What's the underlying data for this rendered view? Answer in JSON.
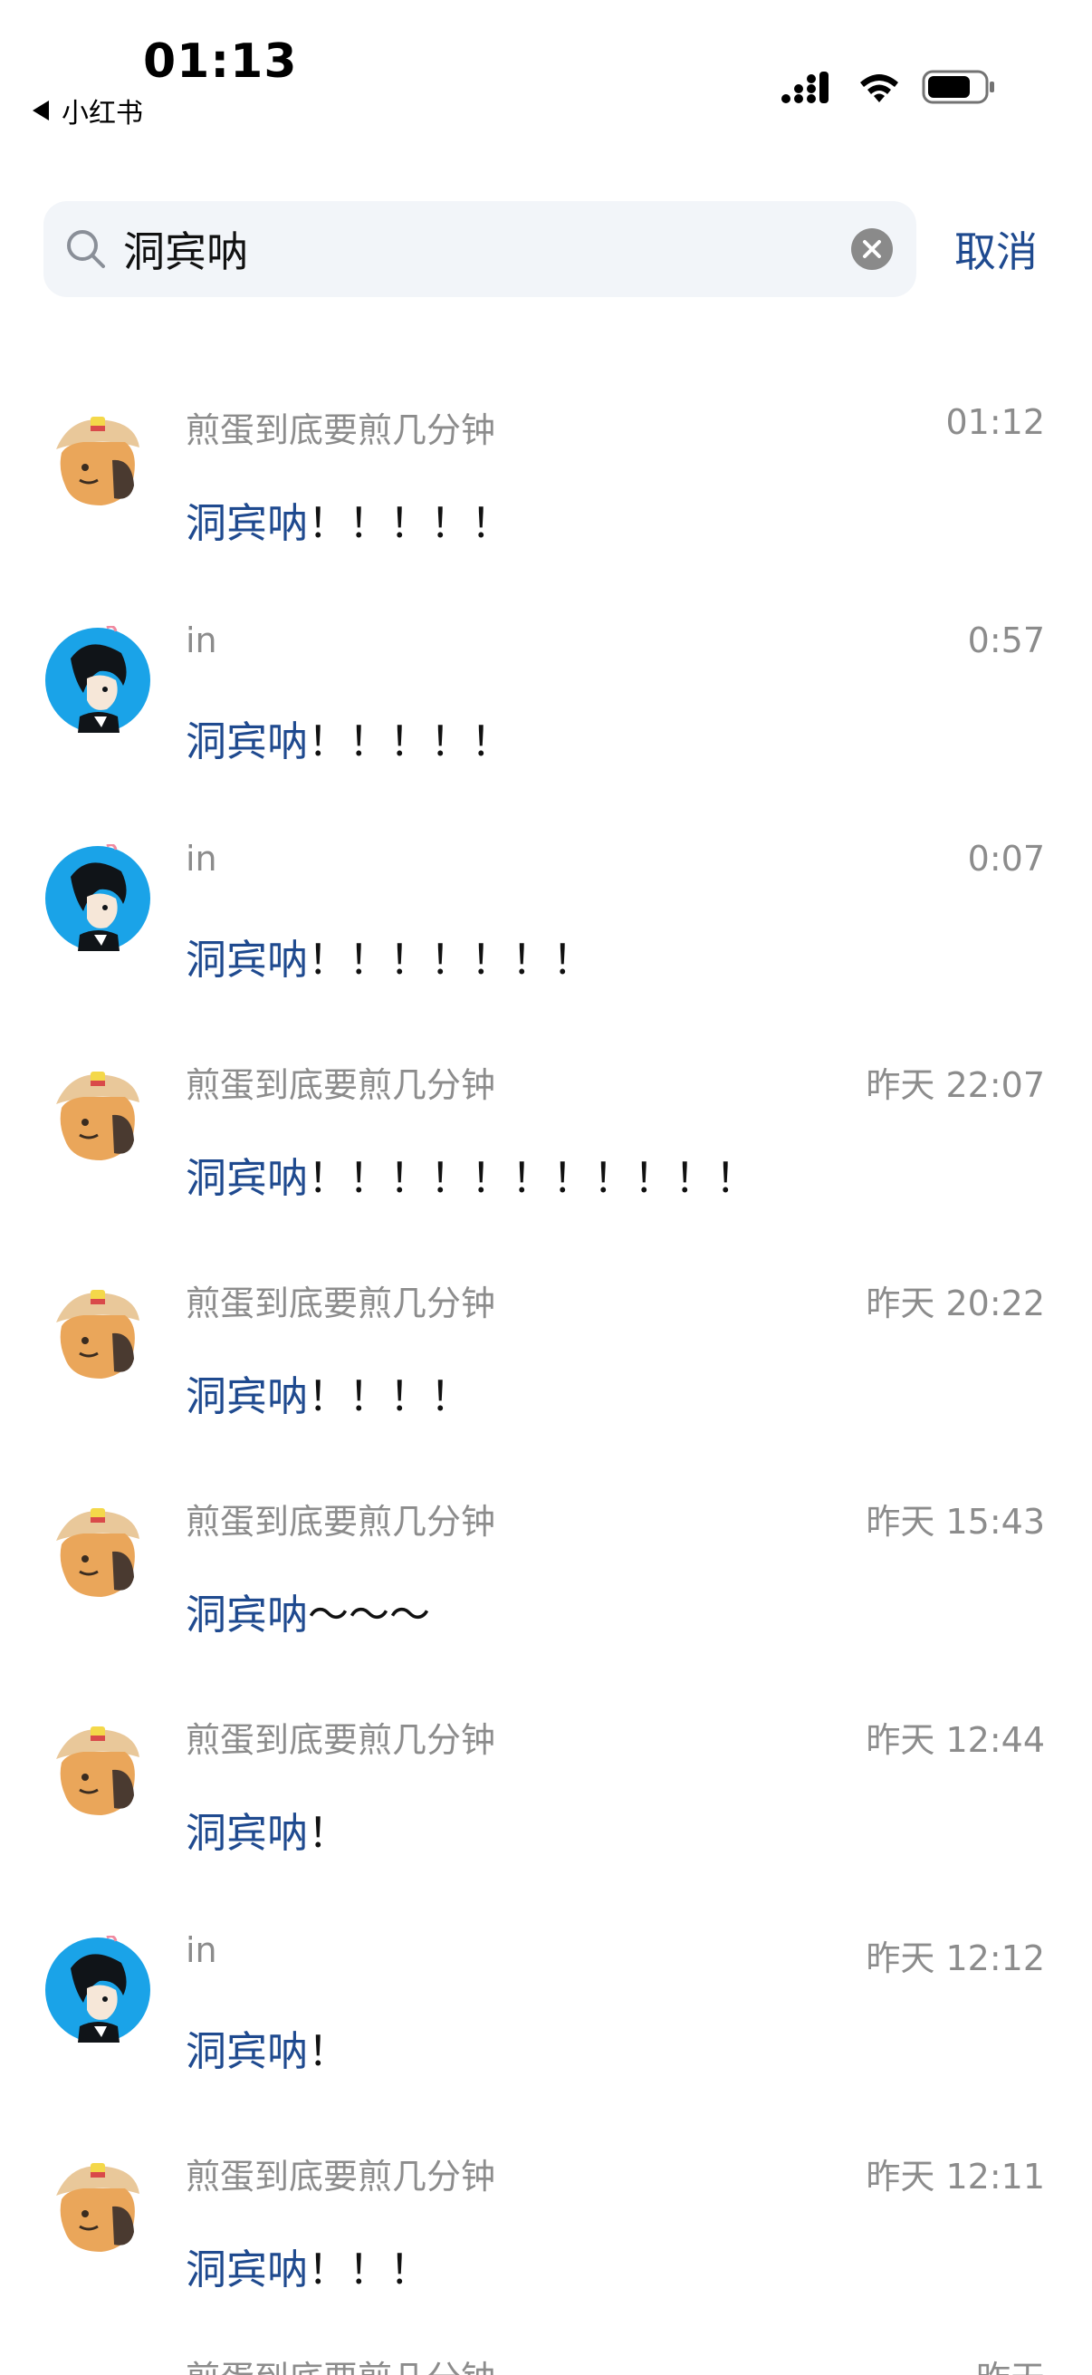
{
  "status_bar": {
    "time": "01:13",
    "back_app_label": "小红书"
  },
  "search": {
    "query": "洞宾呐",
    "cancel_label": "取消"
  },
  "results": [
    {
      "name": "煎蛋到底要煎几分钟",
      "time": "01:12",
      "keyword": "洞宾呐",
      "rest": "！！！！！",
      "avatar": "egg"
    },
    {
      "name": "in",
      "time": "0:57",
      "keyword": "洞宾呐",
      "rest": "！！！！！",
      "avatar": "boy"
    },
    {
      "name": "in",
      "time": "0:07",
      "keyword": "洞宾呐",
      "rest": "！！！！！！！",
      "avatar": "boy"
    },
    {
      "name": "煎蛋到底要煎几分钟",
      "time": "昨天 22:07",
      "keyword": "洞宾呐",
      "rest": "！！！！！！！！！！！",
      "avatar": "egg"
    },
    {
      "name": "煎蛋到底要煎几分钟",
      "time": "昨天 20:22",
      "keyword": "洞宾呐",
      "rest": "！！！！",
      "avatar": "egg"
    },
    {
      "name": "煎蛋到底要煎几分钟",
      "time": "昨天 15:43",
      "keyword": "洞宾呐",
      "rest": "～～～",
      "avatar": "egg"
    },
    {
      "name": "煎蛋到底要煎几分钟",
      "time": "昨天 12:44",
      "keyword": "洞宾呐",
      "rest": "！",
      "avatar": "egg"
    },
    {
      "name": "in",
      "time": "昨天 12:12",
      "keyword": "洞宾呐",
      "rest": "！",
      "avatar": "boy"
    },
    {
      "name": "煎蛋到底要煎几分钟",
      "time": "昨天 12:11",
      "keyword": "洞宾呐",
      "rest": "！！！",
      "avatar": "egg"
    }
  ],
  "partial_row": {
    "name": "煎蛋到底要煎几分钟",
    "time": "昨天"
  },
  "colors": {
    "accent": "#1f4a8f",
    "secondary_text": "#8c8c8c",
    "search_bg": "#f2f5f9",
    "avatar_blue": "#1aa3e8"
  }
}
